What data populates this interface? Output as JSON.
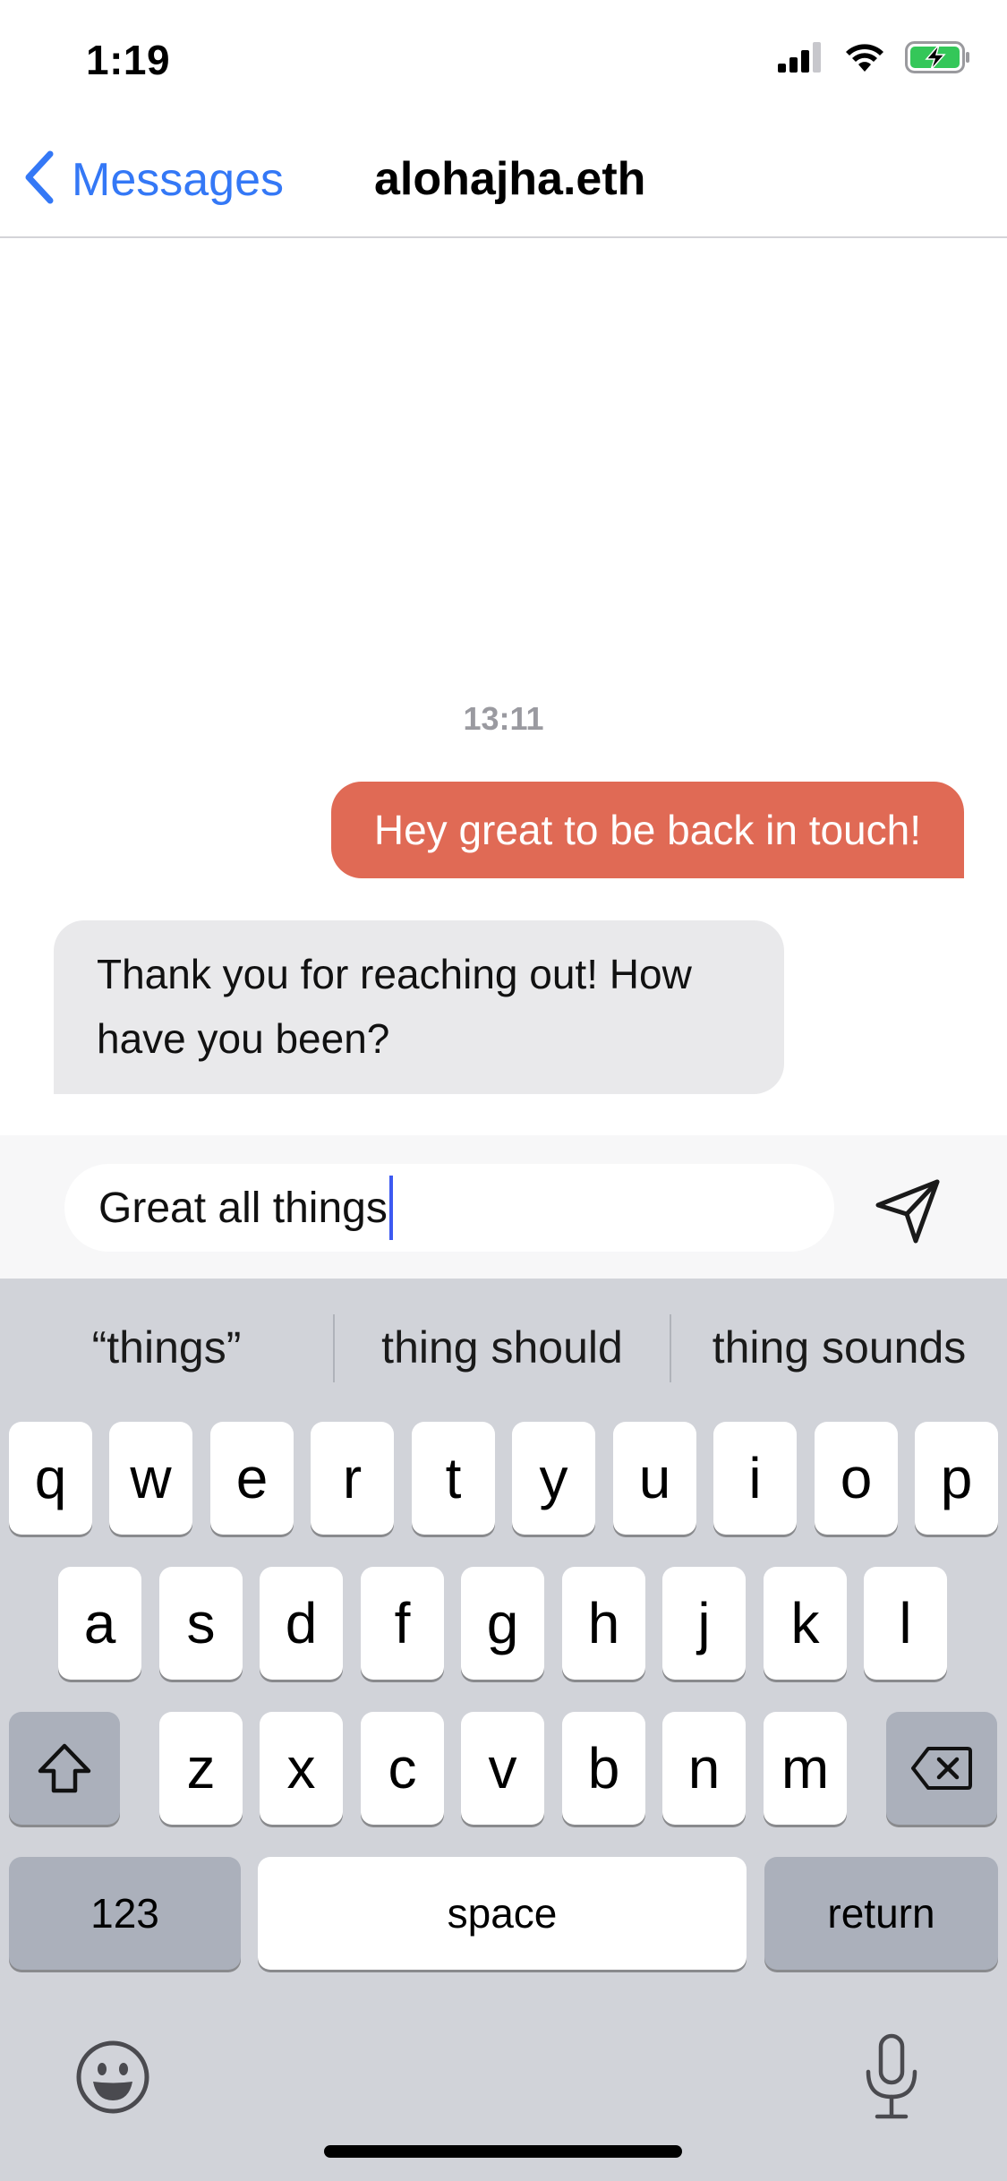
{
  "status": {
    "time": "1:19"
  },
  "nav": {
    "back_label": "Messages",
    "title": "alohajha.eth"
  },
  "chat": {
    "timestamp": "13:11",
    "messages": [
      {
        "direction": "outgoing",
        "text": "Hey great to be back in touch!"
      },
      {
        "direction": "incoming",
        "text": "Thank you for reaching out! How have you been?"
      }
    ]
  },
  "composer": {
    "value": "Great all things"
  },
  "keyboard": {
    "suggestions": [
      "“things”",
      "thing should",
      "thing sounds"
    ],
    "row1": [
      "q",
      "w",
      "e",
      "r",
      "t",
      "y",
      "u",
      "i",
      "o",
      "p"
    ],
    "row2": [
      "a",
      "s",
      "d",
      "f",
      "g",
      "h",
      "j",
      "k",
      "l"
    ],
    "row3": [
      "z",
      "x",
      "c",
      "v",
      "b",
      "n",
      "m"
    ],
    "numbers_label": "123",
    "space_label": "space",
    "return_label": "return"
  },
  "colors": {
    "accent": "#3478f6",
    "outgoing_bubble": "#e06a55",
    "incoming_bubble": "#e9e9eb",
    "keyboard_bg": "#d1d3d9"
  }
}
